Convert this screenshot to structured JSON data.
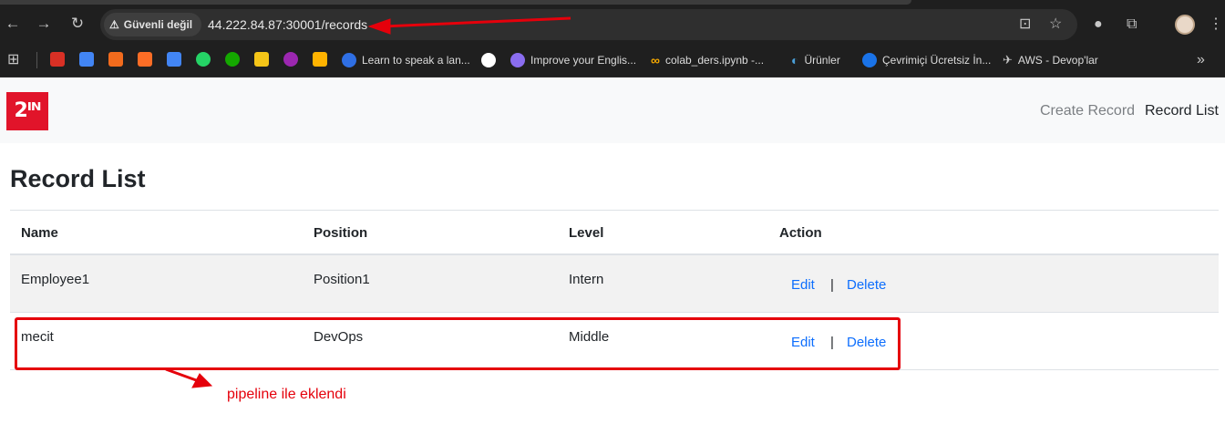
{
  "browser": {
    "security_label": "Güvenli değil",
    "url": "44.222.84.87:30001/records"
  },
  "bookmarks": [
    {
      "label": "Learn to speak a lan...",
      "color": "#2f6fe4"
    },
    {
      "label": "Improve your Englis...",
      "color": "#8a6df0"
    },
    {
      "label": "colab_ders.ipynb -...",
      "color": "#f9ab00"
    },
    {
      "label": "Ürünler",
      "color": "#4a9fd8"
    },
    {
      "label": "Çevrimiçi Ücretsiz İn...",
      "color": "#1a73e8"
    },
    {
      "label": "AWS - Devop'lar",
      "color": "#c7c7c7"
    }
  ],
  "app": {
    "logo_text": "2ᴵᴺ",
    "nav": {
      "create": "Create Record",
      "list": "Record List"
    },
    "title": "Record List",
    "table": {
      "headers": [
        "Name",
        "Position",
        "Level",
        "Action"
      ],
      "rows": [
        {
          "name": "Employee1",
          "position": "Position1",
          "level": "Intern",
          "edit": "Edit",
          "sep": "|",
          "delete": "Delete"
        },
        {
          "name": "mecit",
          "position": "DevOps",
          "level": "Middle",
          "edit": "Edit",
          "sep": "|",
          "delete": "Delete"
        }
      ]
    }
  },
  "annotation": {
    "text": "pipeline ile eklendi",
    "color": "#e5000b"
  }
}
